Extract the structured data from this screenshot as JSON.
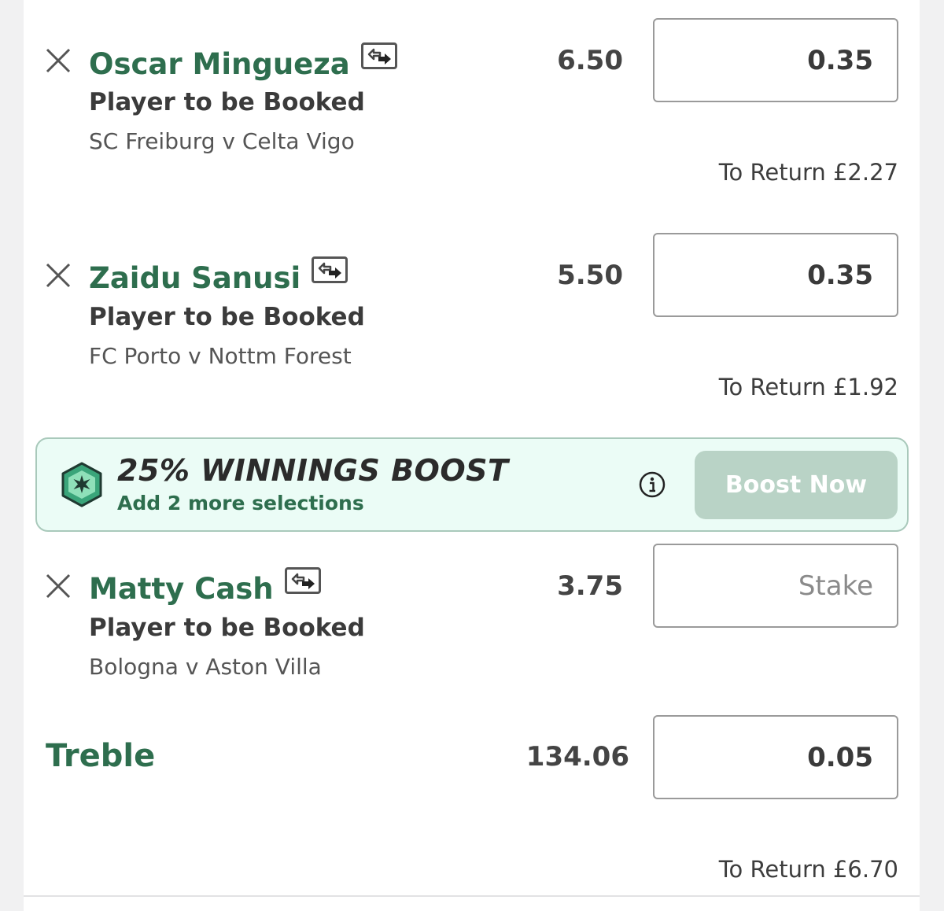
{
  "colors": {
    "brand_green": "#2e6e4e",
    "boost_background": "#ebfcf6",
    "boost_button": "#b9d3c6"
  },
  "selections": [
    {
      "name": "Oscar Mingueza",
      "market": "Player to be Booked",
      "event": "SC Freiburg v Celta Vigo",
      "odds": "6.50",
      "stake": "0.35",
      "to_return": "To Return £2.27"
    },
    {
      "name": "Zaidu Sanusi",
      "market": "Player to be Booked",
      "event": "FC Porto v Nottm Forest",
      "odds": "5.50",
      "stake": "0.35",
      "to_return": "To Return £1.92"
    },
    {
      "name": "Matty Cash",
      "market": "Player to be Booked",
      "event": "Bologna v Aston Villa",
      "odds": "3.75",
      "stake": "",
      "stake_placeholder": "Stake"
    }
  ],
  "boost": {
    "title": "25% WINNINGS BOOST",
    "subtitle": "Add 2 more selections",
    "button_label": "Boost Now",
    "icon": "boost-star-icon",
    "info_icon": "info-icon"
  },
  "multiple": {
    "label": "Treble",
    "odds": "134.06",
    "stake": "0.05",
    "to_return": "To Return £6.70"
  }
}
